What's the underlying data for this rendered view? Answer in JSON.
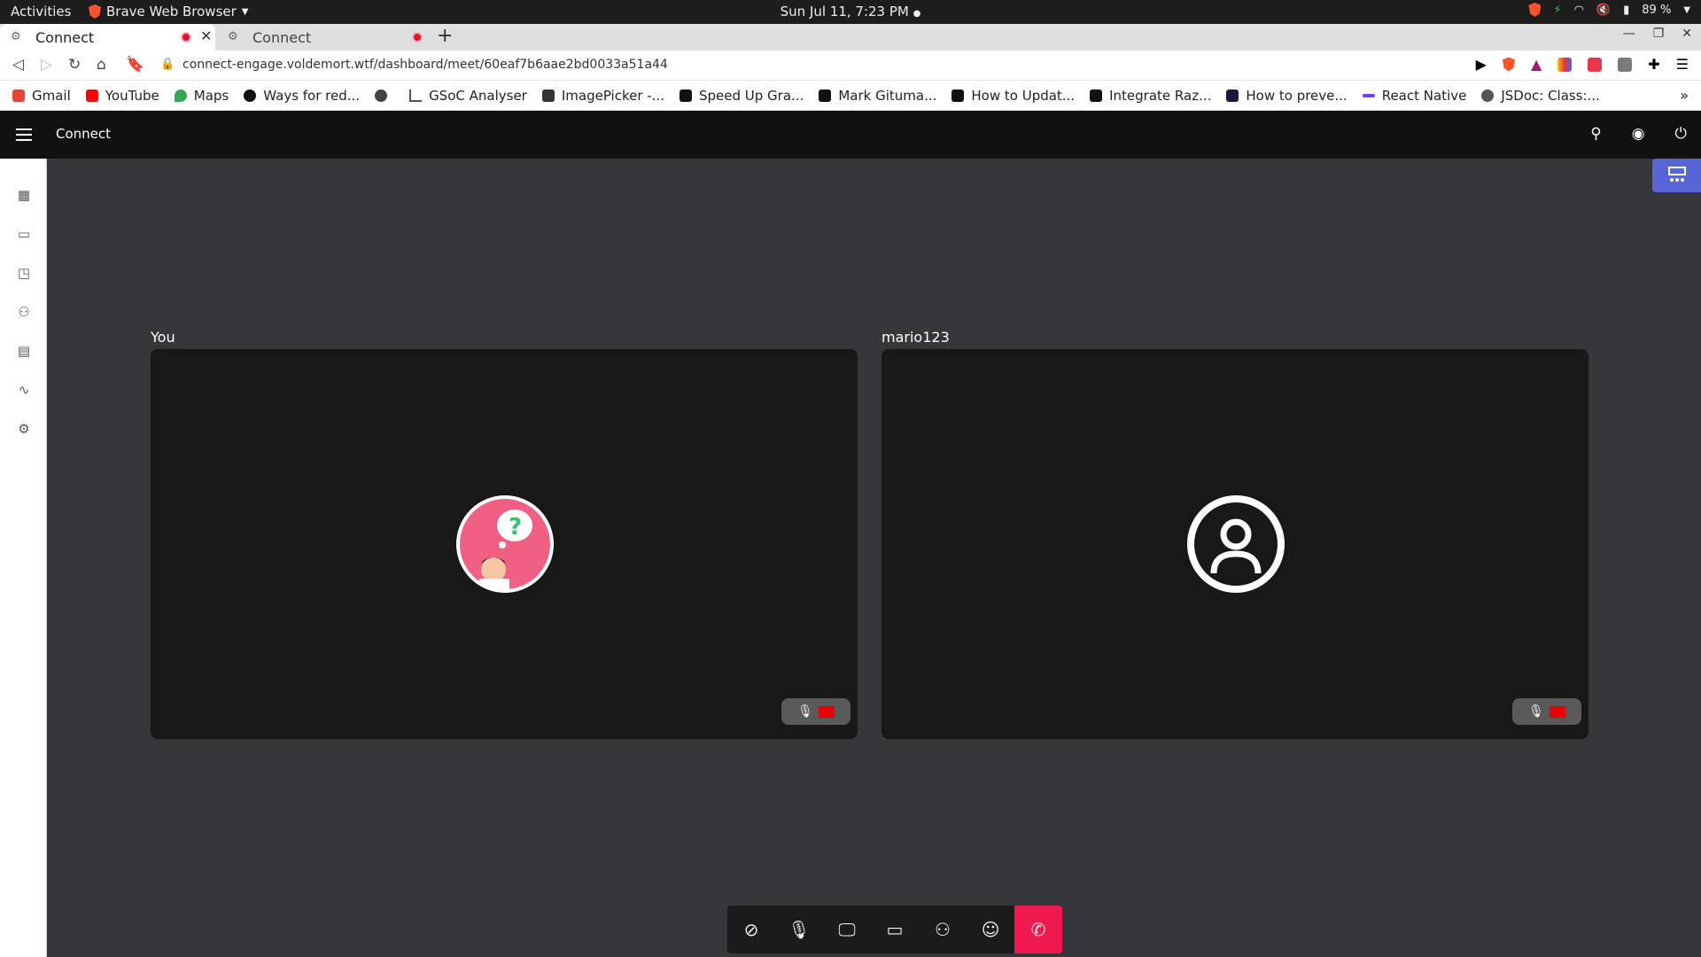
{
  "os": {
    "activities": "Activities",
    "app_name": "Brave Web Browser",
    "clock": "Sun Jul 11,  7:23 PM",
    "battery": "89 %"
  },
  "browser": {
    "tabs": [
      {
        "label": "Connect",
        "active": true
      },
      {
        "label": "Connect",
        "active": false
      }
    ],
    "url": "connect-engage.voldemort.wtf/dashboard/meet/60eaf7b6aae2bd0033a51a44",
    "bookmarks": [
      {
        "label": "Gmail",
        "color": "#ea4335"
      },
      {
        "label": "YouTube",
        "color": "#ff0000"
      },
      {
        "label": "Maps",
        "color": "#34a853"
      },
      {
        "label": "Ways for red...",
        "color": "#111111"
      },
      {
        "label": "",
        "color": "#444444"
      },
      {
        "label": "GSoC Analyser",
        "color": "#555555"
      },
      {
        "label": "ImagePicker -...",
        "color": "#333333"
      },
      {
        "label": "Speed Up Gra...",
        "color": "#111111"
      },
      {
        "label": "Mark Gituma...",
        "color": "#111111"
      },
      {
        "label": "How to Updat...",
        "color": "#111111"
      },
      {
        "label": "Integrate Raz...",
        "color": "#111111"
      },
      {
        "label": "How to preve...",
        "color": "#1a1a3a"
      },
      {
        "label": "React Native",
        "color": "#7c3aed"
      },
      {
        "label": "JSDoc: Class:...",
        "color": "#555555"
      }
    ]
  },
  "app": {
    "title": "Connect",
    "accent": "#5865d6",
    "end_call_color": "#f0194f"
  },
  "meeting": {
    "participants": [
      {
        "name": "You",
        "avatar": "cartoon-avatar"
      },
      {
        "name": "mario123",
        "avatar": "user-icon"
      }
    ]
  }
}
